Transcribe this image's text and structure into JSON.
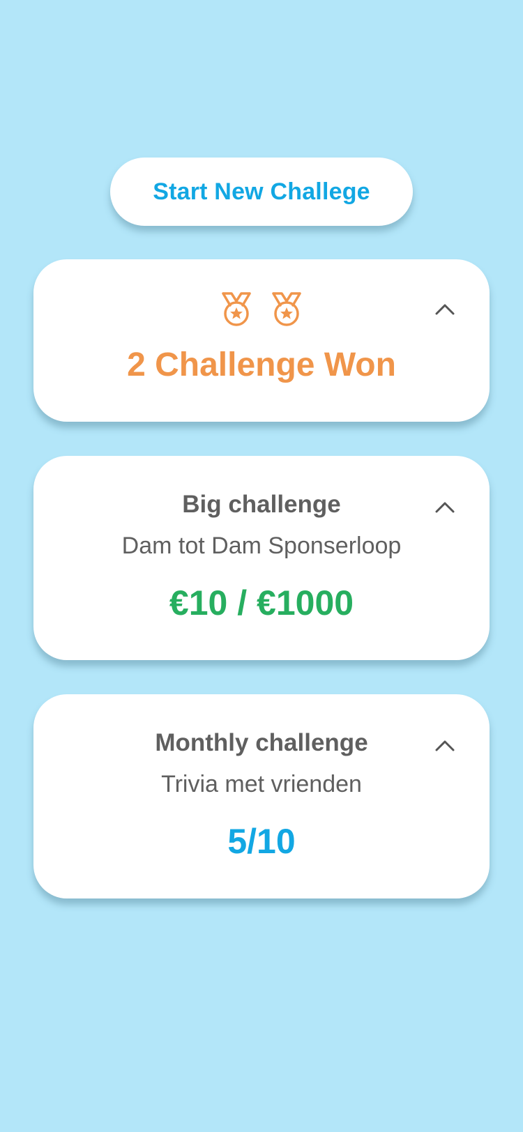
{
  "start_button": {
    "label": "Start New Challege"
  },
  "won_card": {
    "medal_count": 2,
    "title": "2 Challenge Won",
    "accent_color": "#f0954a",
    "icon": "medal-icon"
  },
  "challenges": [
    {
      "title": "Big challenge",
      "subtitle": "Dam tot Dam Sponserloop",
      "progress": "€10 / €1000",
      "progress_color": "#27ae5f"
    },
    {
      "title": "Monthly challenge",
      "subtitle": "Trivia met vrienden",
      "progress": "5/10",
      "progress_color": "#12a7e3"
    }
  ],
  "colors": {
    "background": "#b3e6f9",
    "card": "#ffffff",
    "primary_blue": "#12a7e3",
    "text_gray": "#5f5f5f"
  },
  "icons": {
    "collapse": "chevron-up-icon"
  }
}
